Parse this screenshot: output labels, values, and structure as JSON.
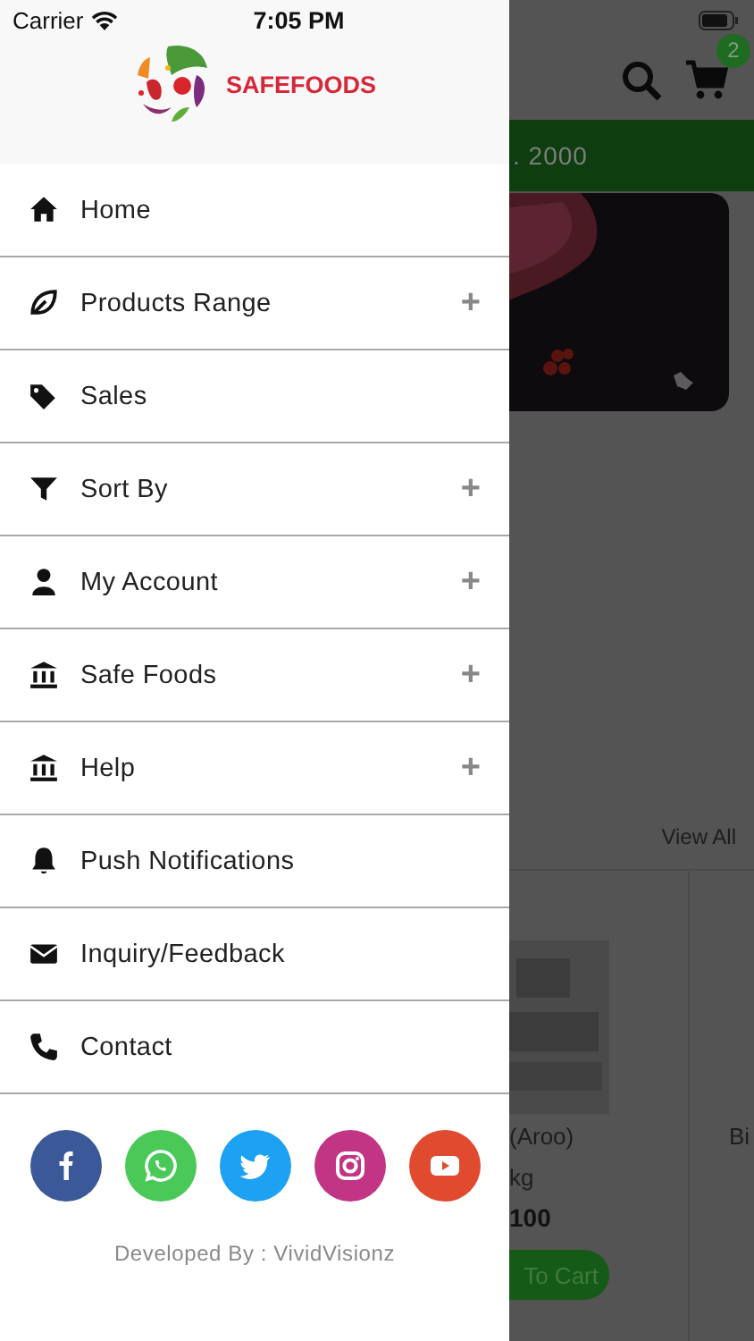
{
  "status_bar": {
    "carrier": "Carrier",
    "time": "7:05 PM"
  },
  "drawer": {
    "logo_text": "SAFEFOODS",
    "menu": [
      {
        "label": "Home"
      },
      {
        "label": "Products Range",
        "toggle": "+"
      },
      {
        "label": "Sales"
      },
      {
        "label": "Sort By",
        "toggle": "+"
      },
      {
        "label": "My Account",
        "toggle": "+"
      },
      {
        "label": "Safe Foods",
        "toggle": "+"
      },
      {
        "label": "Help",
        "toggle": "+"
      },
      {
        "label": "Push Notifications"
      },
      {
        "label": "Inquiry/Feedback"
      },
      {
        "label": "Contact"
      }
    ],
    "social": [
      {
        "color": "#3b5998"
      },
      {
        "color": "#4ac959"
      },
      {
        "color": "#1da1f2"
      },
      {
        "color": "#c13584"
      },
      {
        "color": "#e04a2f"
      }
    ],
    "footer": "Developed By : VividVisionz"
  },
  "background_page": {
    "cart_count": "2",
    "banner_text": ". 2000",
    "section_link": "View All",
    "product": {
      "name": "(Aroo)",
      "unit": "kg",
      "price": "100",
      "button": "To Cart"
    },
    "next_product": {
      "name": "Bi"
    }
  }
}
